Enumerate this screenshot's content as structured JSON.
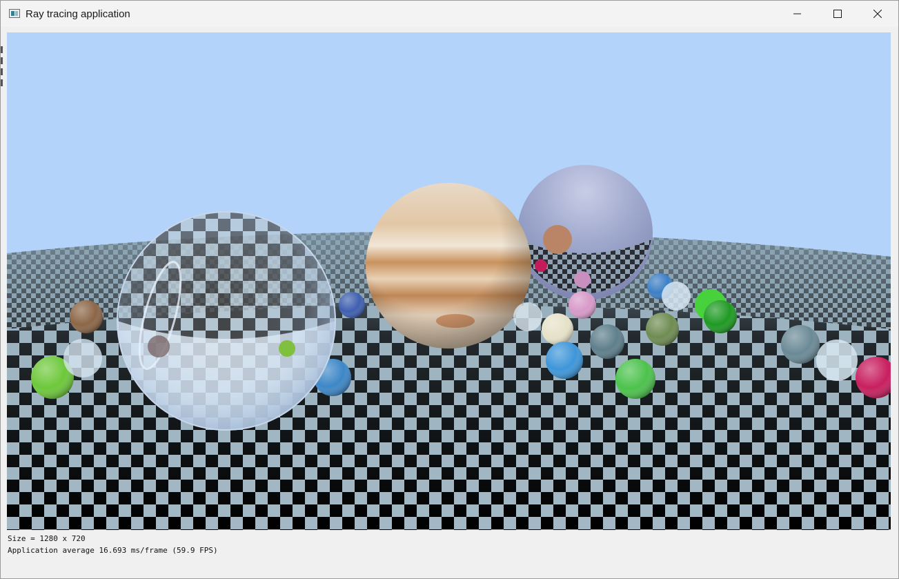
{
  "window": {
    "title": "Ray tracing application",
    "icon": "app-window-icon",
    "controls": {
      "minimize": "minimize-icon",
      "maximize": "maximize-icon",
      "close": "close-icon"
    }
  },
  "viewport": {
    "description_icon": "render-viewport",
    "sky_color": "#b3d3fb",
    "checker_light": "#a3b8c4",
    "checker_dark": "#000000"
  },
  "status": {
    "size_line": "Size = 1280 x 720",
    "perf_line": "Application average 16.693 ms/frame (59.9 FPS)"
  }
}
